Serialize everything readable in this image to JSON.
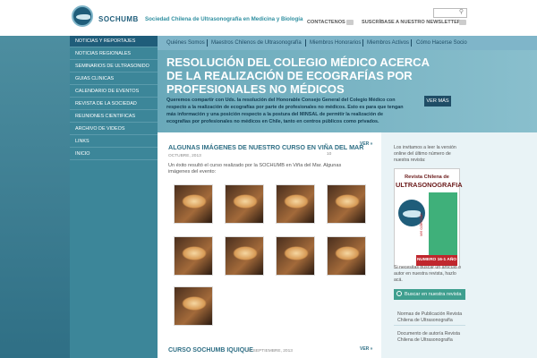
{
  "brand": {
    "name": "SOCHUMB",
    "tagline": "Sociedad Chilena de Ultrasonografía en Medicina y Biología"
  },
  "topnav": {
    "contact": "CONTACTENOS",
    "newsletter": "SUSCRÍBASE A NUESTRO NEWSLETTER"
  },
  "sidebar": {
    "items": [
      {
        "label": "NOTICIAS Y REPORTAJES"
      },
      {
        "label": "NOTICIAS REGIONALES"
      },
      {
        "label": "SEMINARIOS DE ULTRASONIDO"
      },
      {
        "label": "GUIAS CLINICAS"
      },
      {
        "label": "CALENDARIO DE EVENTOS"
      },
      {
        "label": "REVISTA DE LA SOCIEDAD"
      },
      {
        "label": "REUNIONES CIENTIFICAS"
      },
      {
        "label": "ARCHIVO DE VIDEOS"
      },
      {
        "label": "LINKS"
      },
      {
        "label": "INICIO"
      }
    ]
  },
  "nav": {
    "items": [
      {
        "label": "Quiénes Somos"
      },
      {
        "label": "Maestros Chilenos de Ultrasonografía"
      },
      {
        "label": "Miembros Honorarios"
      },
      {
        "label": "Miembros Activos"
      },
      {
        "label": "Cómo Hacerse Socio"
      }
    ]
  },
  "banner": {
    "title": "RESOLUCIÓN DEL COLEGIO MÉDICO ACERCA DE LA REALIZACIÓN DE ECOGRAFÍAS POR PROFESIONALES NO MÉDICOS",
    "text": "Queremos compartir con Uds. la resolución del Honorable Consejo General del Colegio Médico con respecto a la realización de ecografías por parte de profesionales no médicos. Esto es para que tengan más información y una posición respecto a la postura del MINSAL de permitir la realización de ecografías por profesionales no médicos en Chile, tanto en centros públicos como privados.",
    "button": "VER MÁS"
  },
  "posts": [
    {
      "title": "ALGUNAS IMÁGENES DE NUESTRO CURSO EN VIÑA DEL MAR",
      "date_part1": "10",
      "date_part2": "OCTUBRE, 2013",
      "body": "Un éxito resultó el curso realizado por la SOCHUMB en Viña del Mar. Algunas imágenes del evento:",
      "more": "VER »"
    },
    {
      "title": "CURSO SOCHUMB IQUIQUE",
      "date": "21 SEPTIEMBRE, 2013",
      "more": "VER »"
    }
  ],
  "right": {
    "invite": "Los invitamos a leer la versión online del último número de nuestra revista:",
    "cover_top": "Revista Chilena de",
    "cover_title": "ULTRASONOGRAFIA",
    "cover_side": "ver colección",
    "cover_number": "NUMERO 16-1 AÑO 2013",
    "submit_text": "Si necesitas buscar un artículo o autor en nuestra revista, hazlo acá.",
    "search_btn": "Buscar en nuestra revista",
    "link1": "Normas de Publicación Revista Chilena de Ultrasonografía",
    "link2": "Documento de autoría Revista Chilena de Ultrasonografía"
  },
  "icons": {
    "search": "search-icon",
    "mail": "mail-icon",
    "logo": "dolphin-logo"
  },
  "colors": {
    "primary": "#1f5d7a",
    "sidebar": "#3c8699",
    "nav": "#7fb5c9"
  }
}
